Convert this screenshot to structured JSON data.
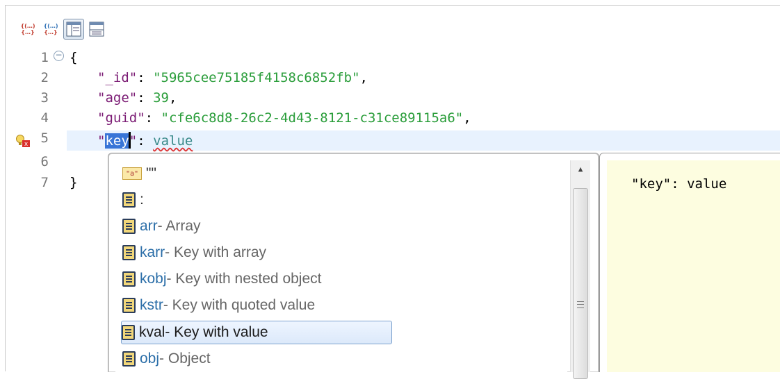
{
  "toolbar": {
    "buttons": [
      {
        "icon": "collapse-all-icon"
      },
      {
        "icon": "expand-all-icon"
      },
      {
        "icon": "split-vertical-icon",
        "active": true
      },
      {
        "icon": "split-horizontal-icon"
      }
    ]
  },
  "editor": {
    "line_numbers": [
      "1",
      "2",
      "3",
      "4",
      "5",
      "6",
      "7"
    ],
    "lines": [
      {
        "open_brace": "{"
      },
      {
        "key": "\"_id\"",
        "sep": ": ",
        "value": "\"5965cee75185f4158c6852fb\"",
        "end": ","
      },
      {
        "key": "\"age\"",
        "sep": ": ",
        "value": "39",
        "end": ","
      },
      {
        "key": "\"guid\"",
        "sep": ": ",
        "value": "\"cfe6c8d8-26c2-4d43-8121-c31ce89115a6\"",
        "end": ","
      },
      {
        "quote_open": "\"",
        "selected_key": "key",
        "quote_close": "\"",
        "sep": ": ",
        "value": "value"
      },
      {},
      {
        "close_brace": "}"
      }
    ]
  },
  "autocomplete": {
    "items": [
      {
        "keyword": "\"\"",
        "description": "",
        "icon": "template-icon",
        "selected": false
      },
      {
        "keyword": ":",
        "description": "",
        "icon": "document-icon",
        "selected": false
      },
      {
        "keyword": "arr",
        "description": " - Array",
        "icon": "document-icon",
        "selected": false
      },
      {
        "keyword": "karr",
        "description": " - Key with array",
        "icon": "document-icon",
        "selected": false
      },
      {
        "keyword": "kobj",
        "description": " - Key with nested object",
        "icon": "document-icon",
        "selected": false
      },
      {
        "keyword": "kstr",
        "description": " - Key with quoted value",
        "icon": "document-icon",
        "selected": false
      },
      {
        "keyword": "kval",
        "description": " - Key with value",
        "icon": "document-icon",
        "selected": true
      },
      {
        "keyword": "obj",
        "description": " - Object",
        "icon": "document-icon",
        "selected": false
      }
    ]
  },
  "preview": {
    "text": "\"key\": value"
  },
  "colors": {
    "key": "#7a1a73",
    "string": "#2a9d3a",
    "selection": "#3875d7",
    "keyword": "#2b6ea8",
    "preview_bg": "#fdfde0"
  }
}
